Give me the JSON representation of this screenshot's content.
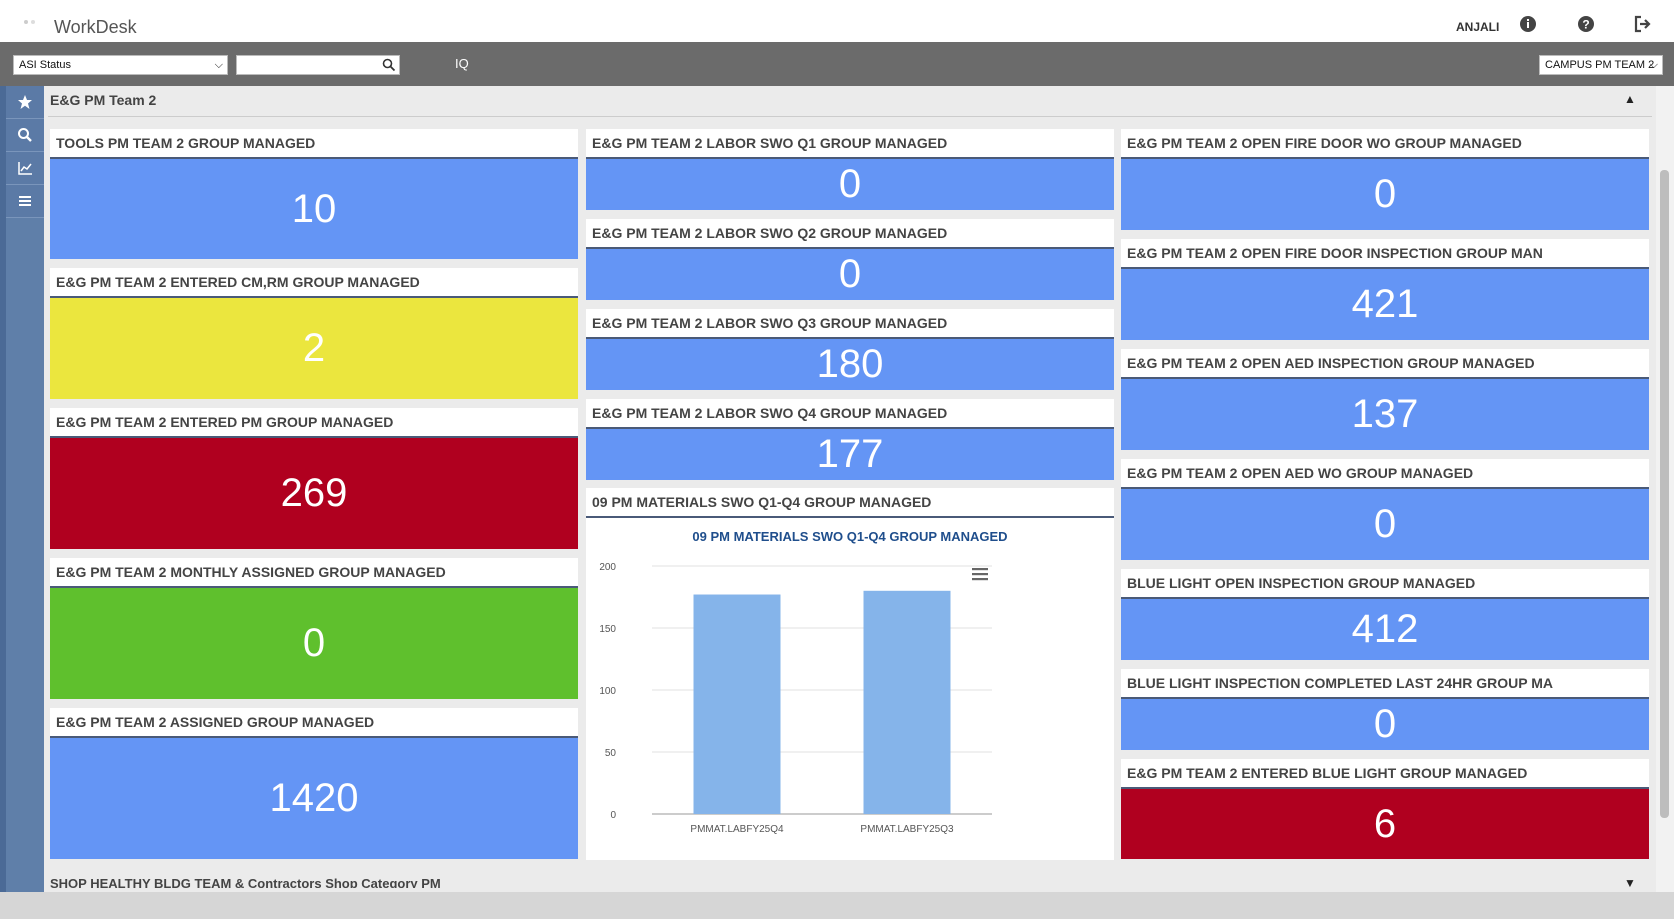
{
  "app": {
    "title": "WorkDesk",
    "user": "ANJALI"
  },
  "toolbar": {
    "status_select": "ASI Status",
    "search_placeholder": "",
    "iq_label": "IQ",
    "team_select": "CAMPUS PM TEAM 2"
  },
  "section": {
    "title": "E&G PM Team 2",
    "next_title": "SHOP HEALTHY BLDG TEAM & Contractors Shop Category PM"
  },
  "tiles": {
    "t1": {
      "title": "TOOLS PM TEAM 2 GROUP MANAGED",
      "value": "10"
    },
    "t2": {
      "title": "E&G PM TEAM 2 ENTERED CM,RM GROUP MANAGED",
      "value": "2"
    },
    "t3": {
      "title": "E&G PM TEAM 2 ENTERED PM GROUP MANAGED",
      "value": "269"
    },
    "t4": {
      "title": "E&G PM TEAM 2 MONTHLY ASSIGNED GROUP MANAGED",
      "value": "0"
    },
    "t5": {
      "title": "E&G PM TEAM 2 ASSIGNED GROUP MANAGED",
      "value": "1420"
    },
    "t6": {
      "title": "E&G PM TEAM 2 LABOR SWO Q1 GROUP MANAGED",
      "value": "0"
    },
    "t7": {
      "title": "E&G PM TEAM 2 LABOR SWO Q2 GROUP MANAGED",
      "value": "0"
    },
    "t8": {
      "title": "E&G PM TEAM 2 LABOR SWO Q3 GROUP MANAGED",
      "value": "180"
    },
    "t9": {
      "title": "E&G PM TEAM 2 LABOR SWO Q4 GROUP MANAGED",
      "value": "177"
    },
    "t10": {
      "title": "E&G PM TEAM 2 OPEN FIRE DOOR WO GROUP MANAGED",
      "value": "0"
    },
    "t11": {
      "title": "E&G PM TEAM 2 OPEN FIRE DOOR INSPECTION GROUP MAN",
      "value": "421"
    },
    "t12": {
      "title": "E&G PM TEAM 2 OPEN AED INSPECTION GROUP MANAGED",
      "value": "137"
    },
    "t13": {
      "title": "E&G PM TEAM 2 OPEN AED WO GROUP MANAGED",
      "value": "0"
    },
    "t14": {
      "title": "BLUE LIGHT OPEN INSPECTION GROUP MANAGED",
      "value": "412"
    },
    "t15": {
      "title": "BLUE LIGHT INSPECTION COMPLETED LAST 24HR GROUP MA",
      "value": "0"
    },
    "t16": {
      "title": "E&G PM TEAM 2 ENTERED BLUE LIGHT GROUP MANAGED",
      "value": "6"
    }
  },
  "chart_card": {
    "title": "09 PM MATERIALS SWO Q1-Q4 GROUP MANAGED"
  },
  "chart_data": {
    "type": "bar",
    "title": "09 PM MATERIALS SWO Q1-Q4 GROUP MANAGED",
    "categories": [
      "PMMAT.LABFY25Q4",
      "PMMAT.LABFY25Q3"
    ],
    "values": [
      177,
      180
    ],
    "xlabel": "",
    "ylabel": "",
    "ylim": [
      0,
      200
    ],
    "yticks": [
      0,
      50,
      100,
      150,
      200
    ],
    "grid": true,
    "bar_color": "#85b4ea",
    "title_color": "#1f4e8c"
  },
  "colors": {
    "blue": "#6495f5",
    "yellow": "#ebe63e",
    "red": "#b0001f",
    "green": "#5fc02d",
    "toolbar": "#6b6b6b",
    "sidebar": "#5f7fa9"
  }
}
